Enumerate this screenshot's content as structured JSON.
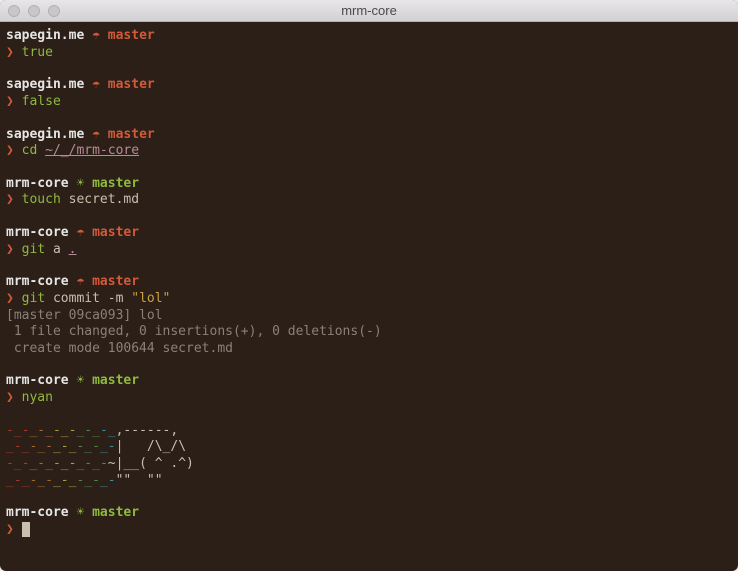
{
  "window": {
    "title": "mrm-core"
  },
  "icons": {
    "umbrella": "☂",
    "sun": "☀"
  },
  "blocks": [
    {
      "dir": "sapegin.me",
      "dirty": true,
      "branch": "master",
      "cmd_green": "true"
    },
    {
      "dir": "sapegin.me",
      "dirty": true,
      "branch": "master",
      "cmd_green": "false"
    },
    {
      "dir": "sapegin.me",
      "dirty": true,
      "branch": "master",
      "cmd_green": "cd",
      "cmd_magenta": "~/_/mrm-core"
    },
    {
      "dir": "mrm-core",
      "dirty": false,
      "branch": "master",
      "cmd_green": "touch",
      "cmd_plain": "secret.md"
    },
    {
      "dir": "mrm-core",
      "dirty": true,
      "branch": "master",
      "cmd_green": "git",
      "cmd_plain": "a",
      "cmd_magenta": "."
    },
    {
      "dir": "mrm-core",
      "dirty": true,
      "branch": "master",
      "cmd_green": "git",
      "cmd_plain": "commit -m",
      "cmd_string": "\"lol\"",
      "output": [
        "[master 09ca093] lol",
        " 1 file changed, 0 insertions(+), 0 deletions(-)",
        " create mode 100644 secret.md"
      ]
    },
    {
      "dir": "mrm-core",
      "dirty": false,
      "branch": "master",
      "cmd_green": "nyan",
      "nyan": true
    },
    {
      "dir": "mrm-core",
      "dirty": false,
      "branch": "master",
      "cursor": true
    }
  ],
  "nyan": {
    "row1": {
      "rainbow": "-_-_-_-_-_-_-_",
      "cat": ",------,"
    },
    "row2": {
      "rainbow": "_-_-_-_-_-_-_-",
      "cat": "|   /\\_/\\"
    },
    "row3": {
      "rainbow": "-_-_-_-_-_-_-",
      "cat": "~|__( ^ .^)"
    },
    "row4": {
      "rainbow": "_-_-_-_-_-_-_-",
      "cat": "\"\"  \"\""
    }
  }
}
